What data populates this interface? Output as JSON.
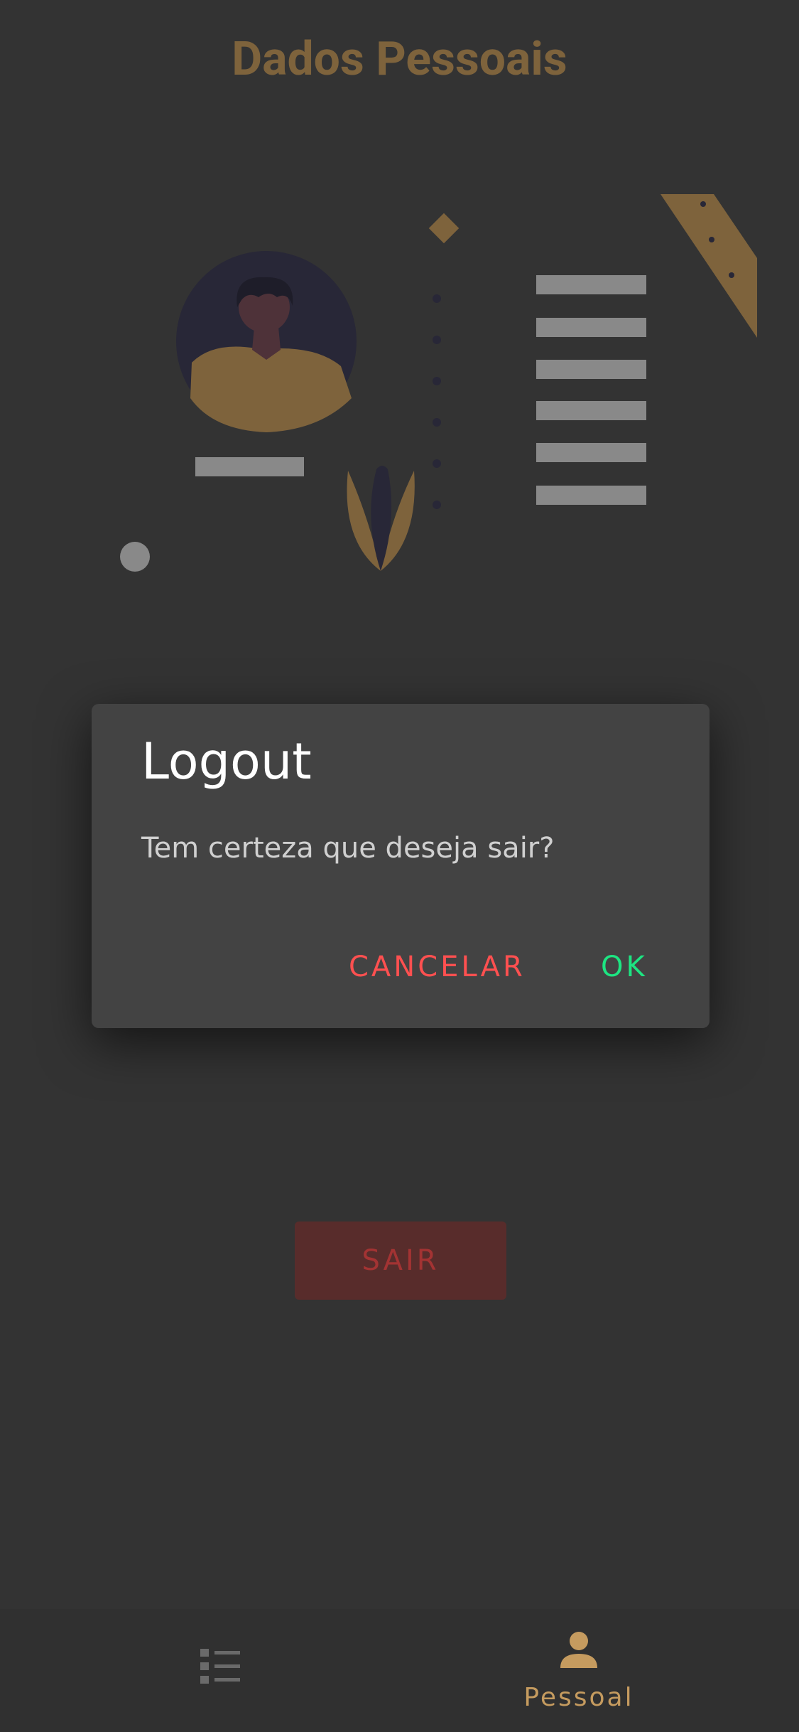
{
  "header": {
    "title": "Dados Pessoais"
  },
  "main": {
    "logout_button_label": "SAIR"
  },
  "dialog": {
    "title": "Logout",
    "message": "Tem certeza que deseja sair?",
    "cancel_label": "CANCELAR",
    "ok_label": "OK"
  },
  "bottom_nav": {
    "items": [
      {
        "icon": "list-icon",
        "label": ""
      },
      {
        "icon": "person-icon",
        "label": "Pessoal",
        "active": true
      }
    ]
  },
  "colors": {
    "background": "#505050",
    "accent": "#c59b5f",
    "danger": "#ff5050",
    "success": "#1de582",
    "dialog_background": "#434343"
  }
}
